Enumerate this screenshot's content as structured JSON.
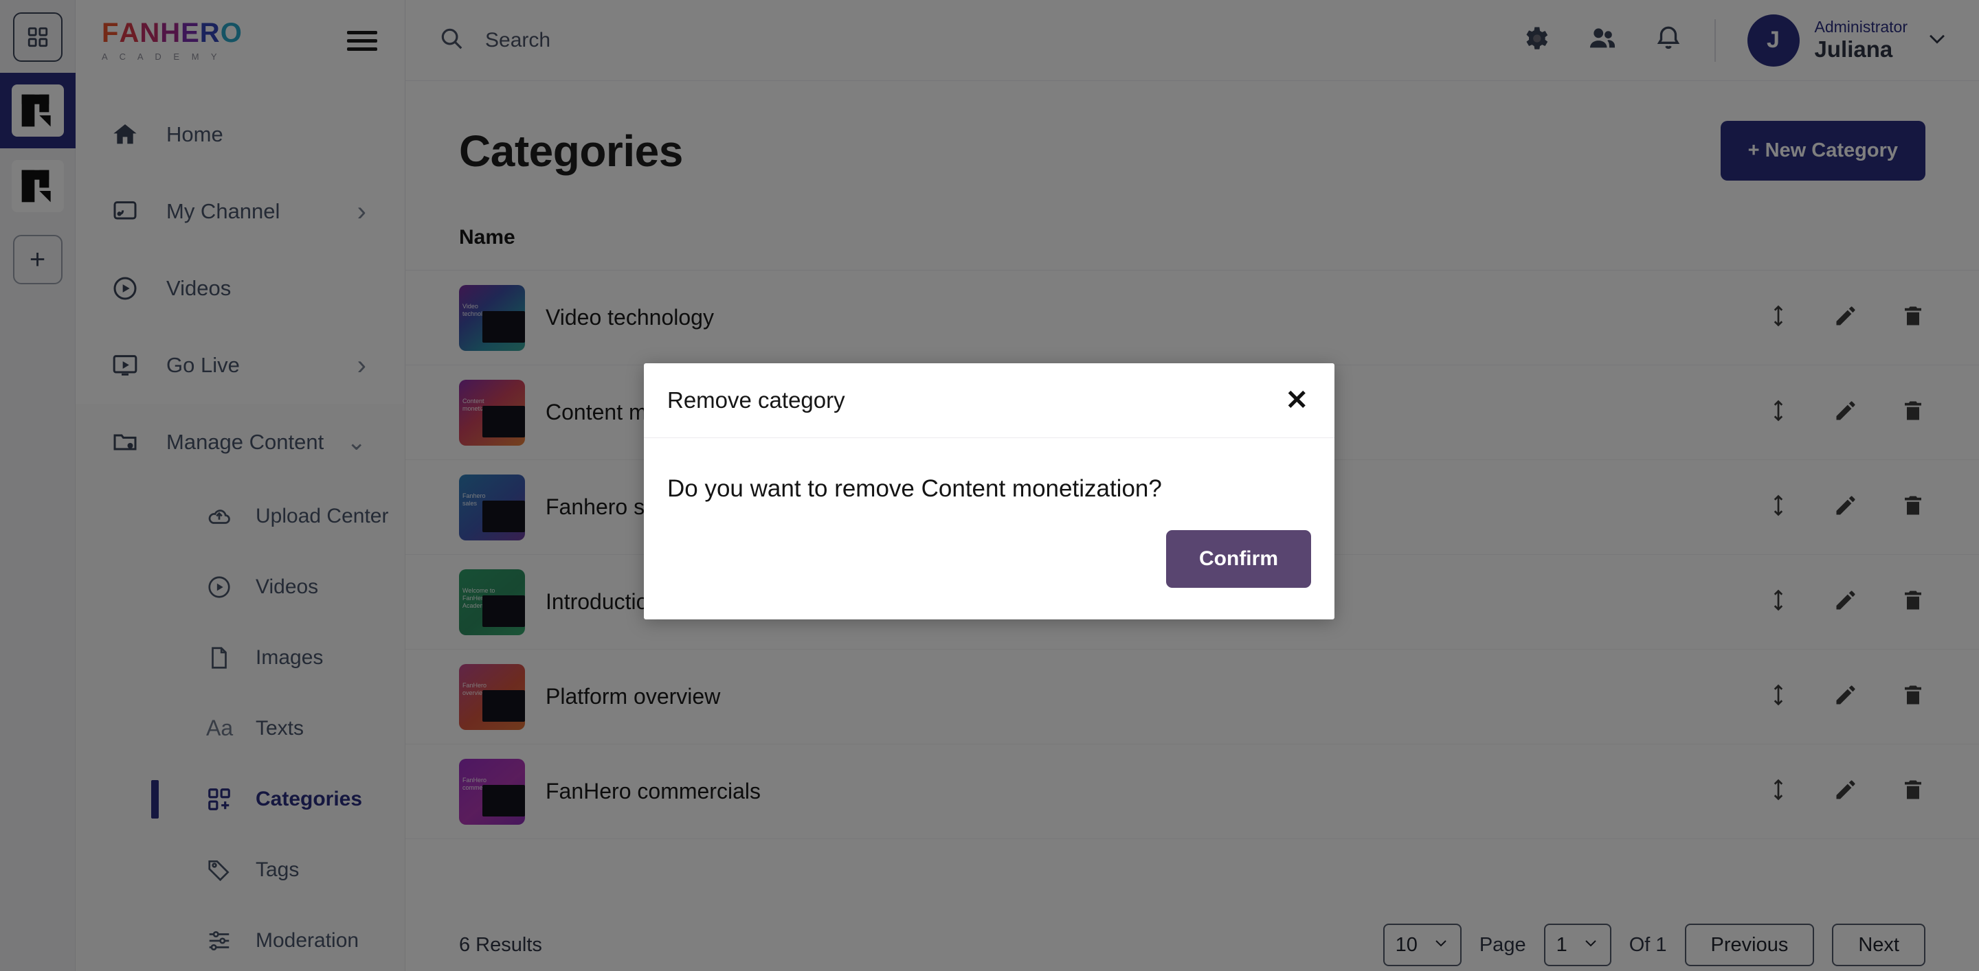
{
  "brand": {
    "name_letters": [
      {
        "ch": "F",
        "color": "#e8542f"
      },
      {
        "ch": "A",
        "color": "#d63b4a"
      },
      {
        "ch": "N",
        "color": "#c0306b"
      },
      {
        "ch": "H",
        "color": "#a32a8c"
      },
      {
        "ch": "E",
        "color": "#7b2fae"
      },
      {
        "ch": "R",
        "color": "#3546b8"
      },
      {
        "ch": "O",
        "color": "#2ba7c9"
      }
    ],
    "subtitle": "A C A D E M Y",
    "avatar_initial": "J"
  },
  "rail": {
    "grid_icon": "grid-icon",
    "workspace_icon": "fanhero-logo-icon",
    "add_label": "+"
  },
  "topbar": {
    "search_placeholder": "Search",
    "icons": [
      "gear-icon",
      "people-icon",
      "bell-icon"
    ],
    "user_role": "Administrator",
    "user_name": "Juliana"
  },
  "sidebar": {
    "items": [
      {
        "label": "Home",
        "icon": "home-icon",
        "chevron": "",
        "active": false
      },
      {
        "label": "My Channel",
        "icon": "channel-icon",
        "chevron": "›",
        "active": false
      },
      {
        "label": "Videos",
        "icon": "play-circle-icon",
        "chevron": "",
        "active": false
      },
      {
        "label": "Go Live",
        "icon": "live-icon",
        "chevron": "›",
        "active": false
      },
      {
        "label": "Manage Content",
        "icon": "folder-gear-icon",
        "chevron": "⌄",
        "active": false
      }
    ],
    "sub_items": [
      {
        "label": "Upload Center",
        "icon": "cloud-upload-icon",
        "active": false
      },
      {
        "label": "Videos",
        "icon": "play-circle-icon",
        "active": false
      },
      {
        "label": "Images",
        "icon": "image-icon",
        "active": false
      },
      {
        "label": "Texts",
        "icon": "text-aa-icon",
        "active": false
      },
      {
        "label": "Categories",
        "icon": "categories-grid-plus-icon",
        "active": true
      },
      {
        "label": "Tags",
        "icon": "tag-icon",
        "active": false
      },
      {
        "label": "Moderation",
        "icon": "sliders-icon",
        "active": false
      }
    ]
  },
  "main": {
    "title": "Categories",
    "new_button": "+ New Category",
    "column_header": "Name",
    "rows": [
      {
        "name": "Video technology",
        "thumb_caption": "Video technology",
        "gradient": "linear-gradient(140deg,#7b2f9e 0%,#3f4fa8 35%,#2f8fa8 70%,#3aa79a 100%)"
      },
      {
        "name": "Content monetization",
        "thumb_caption": "Content monetization",
        "gradient": "linear-gradient(140deg,#8a2fa8 0%,#d0445e 45%,#e8833c 100%)"
      },
      {
        "name": "Fanhero sales",
        "thumb_caption": "Fanhero sales",
        "gradient": "linear-gradient(140deg,#2f7fb8 0%,#3f59b0 55%,#6f3f9e 100%)"
      },
      {
        "name": "Introduction to FanHero",
        "thumb_caption": "Welcome to FanHero Academy",
        "gradient": "linear-gradient(140deg,#2f9e6a 0%,#2e8f62 55%,#37a86f 100%)"
      },
      {
        "name": "Platform overview",
        "thumb_caption": "FanHero overview",
        "gradient": "linear-gradient(140deg,#c04a8e 0%,#d9563f 55%,#e0743a 100%)"
      },
      {
        "name": "FanHero commercials",
        "thumb_caption": "FanHero commercials",
        "gradient": "linear-gradient(140deg,#9b2fc4 0%,#b43ab8 55%,#8e2fb8 100%)"
      }
    ],
    "row_actions": [
      "reorder-icon",
      "edit-icon",
      "delete-icon"
    ]
  },
  "pagination": {
    "results": "6 Results",
    "page_size": "10",
    "page_label": "Page",
    "page_number": "1",
    "of_label": "Of 1",
    "previous": "Previous",
    "next": "Next"
  },
  "modal": {
    "title": "Remove category",
    "close": "✕",
    "message": "Do you want to remove Content monetization?",
    "confirm": "Confirm",
    "confirm_color": "#594570"
  },
  "colors": {
    "accent": "#2b2f80",
    "text": "#49546b",
    "overlay": "rgba(0,0,0,0.5)"
  }
}
